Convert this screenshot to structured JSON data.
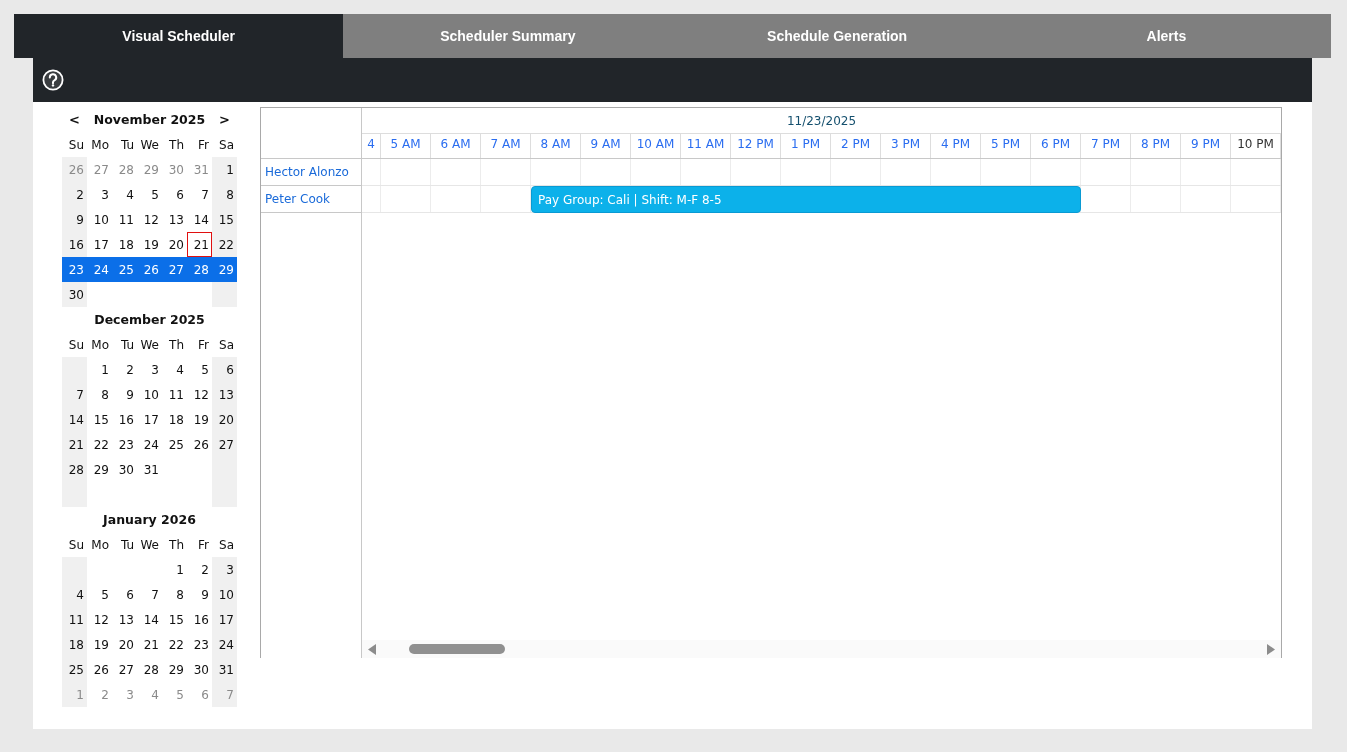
{
  "tabs": [
    {
      "label": "Visual Scheduler",
      "selected": true
    },
    {
      "label": "Scheduler Summary",
      "selected": false
    },
    {
      "label": "Schedule Generation",
      "selected": false
    },
    {
      "label": "Alerts",
      "selected": false
    }
  ],
  "calendars": [
    {
      "title": "November 2025",
      "prev": "<",
      "next": ">",
      "weekdays": [
        "Su",
        "Mo",
        "Tu",
        "We",
        "Th",
        "Fr",
        "Sa"
      ],
      "weeks": [
        {
          "selected": false,
          "days": [
            {
              "label": "26",
              "muted": true,
              "today": false
            },
            {
              "label": "27",
              "muted": true,
              "today": false
            },
            {
              "label": "28",
              "muted": true,
              "today": false
            },
            {
              "label": "29",
              "muted": true,
              "today": false
            },
            {
              "label": "30",
              "muted": true,
              "today": false
            },
            {
              "label": "31",
              "muted": true,
              "today": false
            },
            {
              "label": "1",
              "muted": false,
              "today": false
            }
          ]
        },
        {
          "selected": false,
          "days": [
            {
              "label": "2",
              "muted": false,
              "today": false
            },
            {
              "label": "3",
              "muted": false,
              "today": false
            },
            {
              "label": "4",
              "muted": false,
              "today": false
            },
            {
              "label": "5",
              "muted": false,
              "today": false
            },
            {
              "label": "6",
              "muted": false,
              "today": false
            },
            {
              "label": "7",
              "muted": false,
              "today": false
            },
            {
              "label": "8",
              "muted": false,
              "today": false
            }
          ]
        },
        {
          "selected": false,
          "days": [
            {
              "label": "9",
              "muted": false,
              "today": false
            },
            {
              "label": "10",
              "muted": false,
              "today": false
            },
            {
              "label": "11",
              "muted": false,
              "today": false
            },
            {
              "label": "12",
              "muted": false,
              "today": false
            },
            {
              "label": "13",
              "muted": false,
              "today": false
            },
            {
              "label": "14",
              "muted": false,
              "today": false
            },
            {
              "label": "15",
              "muted": false,
              "today": false
            }
          ]
        },
        {
          "selected": false,
          "days": [
            {
              "label": "16",
              "muted": false,
              "today": false
            },
            {
              "label": "17",
              "muted": false,
              "today": false
            },
            {
              "label": "18",
              "muted": false,
              "today": false
            },
            {
              "label": "19",
              "muted": false,
              "today": false
            },
            {
              "label": "20",
              "muted": false,
              "today": false
            },
            {
              "label": "21",
              "muted": false,
              "today": true
            },
            {
              "label": "22",
              "muted": false,
              "today": false
            }
          ]
        },
        {
          "selected": true,
          "days": [
            {
              "label": "23",
              "muted": false,
              "today": false
            },
            {
              "label": "24",
              "muted": false,
              "today": false
            },
            {
              "label": "25",
              "muted": false,
              "today": false
            },
            {
              "label": "26",
              "muted": false,
              "today": false
            },
            {
              "label": "27",
              "muted": false,
              "today": false
            },
            {
              "label": "28",
              "muted": false,
              "today": false
            },
            {
              "label": "29",
              "muted": false,
              "today": false
            }
          ]
        },
        {
          "selected": false,
          "days": [
            {
              "label": "30",
              "muted": false,
              "today": false
            }
          ]
        }
      ]
    },
    {
      "title": "December 2025",
      "weekdays": [
        "Su",
        "Mo",
        "Tu",
        "We",
        "Th",
        "Fr",
        "Sa"
      ],
      "weeks": [
        {
          "selected": false,
          "days": [
            {
              "label": "1",
              "muted": false,
              "today": false
            },
            {
              "label": "2",
              "muted": false,
              "today": false
            },
            {
              "label": "3",
              "muted": false,
              "today": false
            },
            {
              "label": "4",
              "muted": false,
              "today": false
            },
            {
              "label": "5",
              "muted": false,
              "today": false
            },
            {
              "label": "6",
              "muted": false,
              "today": false
            }
          ]
        },
        {
          "selected": false,
          "days": [
            {
              "label": "7",
              "muted": false,
              "today": false
            },
            {
              "label": "8",
              "muted": false,
              "today": false
            },
            {
              "label": "9",
              "muted": false,
              "today": false
            },
            {
              "label": "10",
              "muted": false,
              "today": false
            },
            {
              "label": "11",
              "muted": false,
              "today": false
            },
            {
              "label": "12",
              "muted": false,
              "today": false
            },
            {
              "label": "13",
              "muted": false,
              "today": false
            }
          ]
        },
        {
          "selected": false,
          "days": [
            {
              "label": "14",
              "muted": false,
              "today": false
            },
            {
              "label": "15",
              "muted": false,
              "today": false
            },
            {
              "label": "16",
              "muted": false,
              "today": false
            },
            {
              "label": "17",
              "muted": false,
              "today": false
            },
            {
              "label": "18",
              "muted": false,
              "today": false
            },
            {
              "label": "19",
              "muted": false,
              "today": false
            },
            {
              "label": "20",
              "muted": false,
              "today": false
            }
          ]
        },
        {
          "selected": false,
          "days": [
            {
              "label": "21",
              "muted": false,
              "today": false
            },
            {
              "label": "22",
              "muted": false,
              "today": false
            },
            {
              "label": "23",
              "muted": false,
              "today": false
            },
            {
              "label": "24",
              "muted": false,
              "today": false
            },
            {
              "label": "25",
              "muted": false,
              "today": false
            },
            {
              "label": "26",
              "muted": false,
              "today": false
            },
            {
              "label": "27",
              "muted": false,
              "today": false
            }
          ]
        },
        {
          "selected": false,
          "days": [
            {
              "label": "28",
              "muted": false,
              "today": false
            },
            {
              "label": "29",
              "muted": false,
              "today": false
            },
            {
              "label": "30",
              "muted": false,
              "today": false
            },
            {
              "label": "31",
              "muted": false,
              "today": false
            }
          ]
        }
      ]
    },
    {
      "title": "January 2026",
      "weekdays": [
        "Su",
        "Mo",
        "Tu",
        "We",
        "Th",
        "Fr",
        "Sa"
      ],
      "weeks": [
        {
          "selected": false,
          "days": [
            {
              "label": "1",
              "muted": false,
              "today": false
            },
            {
              "label": "2",
              "muted": false,
              "today": false
            },
            {
              "label": "3",
              "muted": false,
              "today": false
            }
          ]
        },
        {
          "selected": false,
          "days": [
            {
              "label": "4",
              "muted": false,
              "today": false
            },
            {
              "label": "5",
              "muted": false,
              "today": false
            },
            {
              "label": "6",
              "muted": false,
              "today": false
            },
            {
              "label": "7",
              "muted": false,
              "today": false
            },
            {
              "label": "8",
              "muted": false,
              "today": false
            },
            {
              "label": "9",
              "muted": false,
              "today": false
            },
            {
              "label": "10",
              "muted": false,
              "today": false
            }
          ]
        },
        {
          "selected": false,
          "days": [
            {
              "label": "11",
              "muted": false,
              "today": false
            },
            {
              "label": "12",
              "muted": false,
              "today": false
            },
            {
              "label": "13",
              "muted": false,
              "today": false
            },
            {
              "label": "14",
              "muted": false,
              "today": false
            },
            {
              "label": "15",
              "muted": false,
              "today": false
            },
            {
              "label": "16",
              "muted": false,
              "today": false
            },
            {
              "label": "17",
              "muted": false,
              "today": false
            }
          ]
        },
        {
          "selected": false,
          "days": [
            {
              "label": "18",
              "muted": false,
              "today": false
            },
            {
              "label": "19",
              "muted": false,
              "today": false
            },
            {
              "label": "20",
              "muted": false,
              "today": false
            },
            {
              "label": "21",
              "muted": false,
              "today": false
            },
            {
              "label": "22",
              "muted": false,
              "today": false
            },
            {
              "label": "23",
              "muted": false,
              "today": false
            },
            {
              "label": "24",
              "muted": false,
              "today": false
            }
          ]
        },
        {
          "selected": false,
          "days": [
            {
              "label": "25",
              "muted": false,
              "today": false
            },
            {
              "label": "26",
              "muted": false,
              "today": false
            },
            {
              "label": "27",
              "muted": false,
              "today": false
            },
            {
              "label": "28",
              "muted": false,
              "today": false
            },
            {
              "label": "29",
              "muted": false,
              "today": false
            },
            {
              "label": "30",
              "muted": false,
              "today": false
            },
            {
              "label": "31",
              "muted": false,
              "today": false
            }
          ]
        },
        {
          "selected": false,
          "days": [
            {
              "label": "1",
              "muted": true,
              "today": false
            },
            {
              "label": "2",
              "muted": true,
              "today": false
            },
            {
              "label": "3",
              "muted": true,
              "today": false
            },
            {
              "label": "4",
              "muted": true,
              "today": false
            },
            {
              "label": "5",
              "muted": true,
              "today": false
            },
            {
              "label": "6",
              "muted": true,
              "today": false
            },
            {
              "label": "7",
              "muted": true,
              "today": false
            }
          ]
        }
      ]
    }
  ],
  "scheduler": {
    "date": "11/23/2025",
    "hours": [
      {
        "label": "4",
        "hovered": false
      },
      {
        "label": "5 AM",
        "hovered": false
      },
      {
        "label": "6 AM",
        "hovered": false
      },
      {
        "label": "7 AM",
        "hovered": false
      },
      {
        "label": "8 AM",
        "hovered": false
      },
      {
        "label": "9 AM",
        "hovered": false
      },
      {
        "label": "10 AM",
        "hovered": false
      },
      {
        "label": "11 AM",
        "hovered": false
      },
      {
        "label": "12 PM",
        "hovered": false
      },
      {
        "label": "1 PM",
        "hovered": false
      },
      {
        "label": "2 PM",
        "hovered": false
      },
      {
        "label": "3 PM",
        "hovered": false
      },
      {
        "label": "4 PM",
        "hovered": false
      },
      {
        "label": "5 PM",
        "hovered": false
      },
      {
        "label": "6 PM",
        "hovered": false
      },
      {
        "label": "7 PM",
        "hovered": false
      },
      {
        "label": "8 PM",
        "hovered": false
      },
      {
        "label": "9 PM",
        "hovered": false
      },
      {
        "label": "10 PM",
        "hovered": true
      }
    ],
    "resources": [
      {
        "name": "Hector Alonzo"
      },
      {
        "name": "Peter Cook",
        "events": [
          {
            "label": "Pay Group: Cali | Shift: M-F 8-5"
          }
        ]
      }
    ]
  }
}
